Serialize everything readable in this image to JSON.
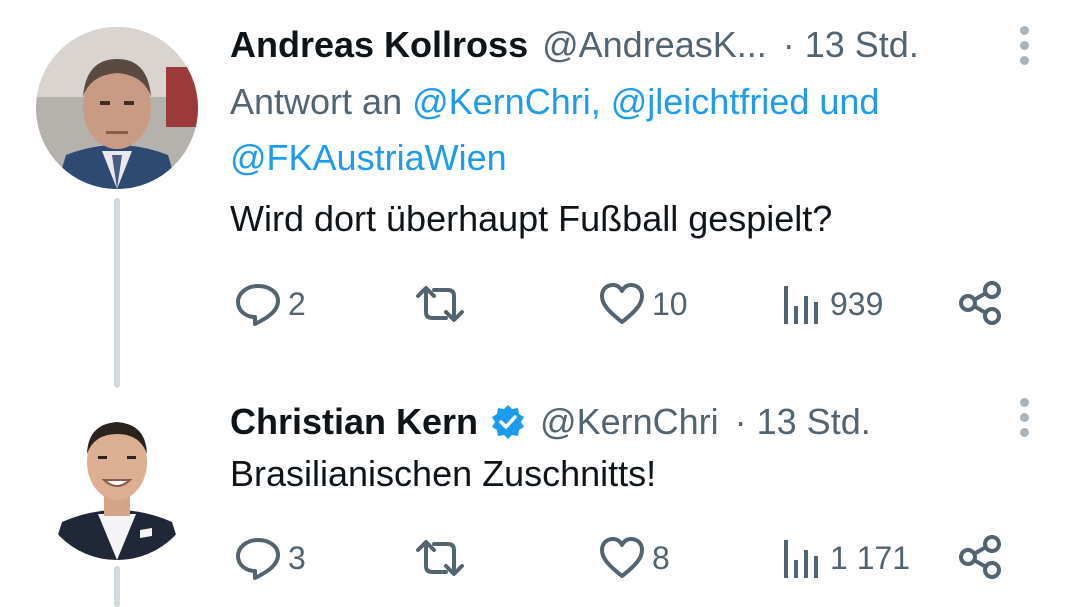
{
  "tweets": [
    {
      "name": "Andreas Kollross",
      "handle": "@AndreasK...",
      "separator": "·",
      "time": "13 Std.",
      "verified": false,
      "replying_prefix": "Antwort an",
      "mentions": [
        "@KernChri,",
        "@jleichtfried",
        "und",
        "@FKAustriaWien"
      ],
      "text": "Wird dort überhaupt Fußball gespielt?",
      "replies": "2",
      "retweets": "",
      "likes": "10",
      "views": "939"
    },
    {
      "name": "Christian Kern",
      "handle": "@KernChri",
      "separator": "·",
      "time": "13 Std.",
      "verified": true,
      "text": "Brasilianischen Zuschnitts!",
      "replies": "3",
      "retweets": "",
      "likes": "8",
      "views": "1 171"
    }
  ],
  "icons": {
    "reply": "reply-bubble-icon",
    "retweet": "retweet-arrows-icon",
    "like": "heart-icon",
    "views": "bar-chart-icon",
    "share": "share-nodes-icon",
    "more": "more-vertical-icon",
    "verified": "verified-badge-icon"
  },
  "colors": {
    "link": "#1d9bf0",
    "muted": "#536471",
    "text": "#0f1419",
    "thread_line": "#cfd9de"
  }
}
